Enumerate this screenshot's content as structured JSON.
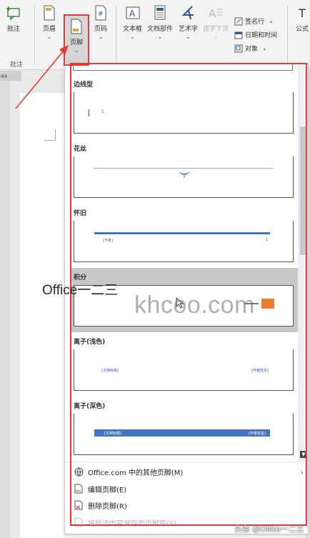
{
  "ribbon": {
    "comment": {
      "label": "批注",
      "group": "批注"
    },
    "header": {
      "label": "页眉"
    },
    "footer": {
      "label": "页脚"
    },
    "page_number": {
      "label": "页码"
    },
    "textbox": {
      "label": "文本框"
    },
    "doc_parts": {
      "label": "文档部件"
    },
    "wordart": {
      "label": "艺术字"
    },
    "dropcap": {
      "label": "首字下沉"
    },
    "signature_line": {
      "label": "签名行"
    },
    "datetime": {
      "label": "日期和时间"
    },
    "object": {
      "label": "对象"
    },
    "formula_partial": {
      "label": "公式"
    }
  },
  "ruler": {
    "number": "44"
  },
  "gallery": {
    "items": [
      {
        "title": "边线型",
        "thumb_text": "1"
      },
      {
        "title": "花丝"
      },
      {
        "title": "怀旧",
        "thumb_left": "[作者]",
        "thumb_right": "1"
      },
      {
        "title": "积分"
      },
      {
        "title": "离子(浅色)",
        "thumb_left": "[文档标题]",
        "thumb_right": "[作者姓名]"
      },
      {
        "title": "离子(深色)",
        "thumb_left": "[文档标题]",
        "thumb_right": "[作者姓名]"
      }
    ]
  },
  "menu": {
    "more_footers": "Office.com 中的其他页脚(M)",
    "edit_footer": "编辑页脚(E)",
    "delete_footer": "删除页脚(R)",
    "save_selection": "将所选内容保存到页脚库(S)..."
  },
  "watermarks": {
    "office": "Office一二三",
    "khcoo": "khcoo.com",
    "bottom": "头条 @Office一二三"
  },
  "colors": {
    "annotation_red": "#e53935",
    "accent_blue": "#4472c4"
  }
}
